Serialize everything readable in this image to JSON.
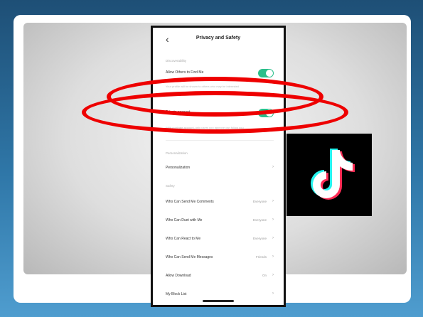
{
  "screen": {
    "title": "Privacy and Safety",
    "back_icon": "chevron-left-icon",
    "discoverability_header": "Discoverability",
    "allow_find_label": "Allow Others to Find Me",
    "allow_find_desc": "Your profile will be shown to others who may be interested",
    "private_label": "Private account",
    "private_desc": "With a private account, only users you approve can follow you",
    "personalization_header": "Personalization",
    "personalization_label": "Personalization",
    "safety_header": "Safety",
    "rows": [
      {
        "label": "Who Can Send Me Comments",
        "value": "Everyone"
      },
      {
        "label": "Who Can Duet with Me",
        "value": "Everyone"
      },
      {
        "label": "Who Can React to Me",
        "value": "Everyone"
      },
      {
        "label": "Who Can Send Me Messages",
        "value": "Friends"
      },
      {
        "label": "Allow Download",
        "value": "On"
      },
      {
        "label": "My Block List",
        "value": ""
      }
    ]
  },
  "toggles": {
    "allow_find": true,
    "private_account": true
  },
  "colors": {
    "toggle_on": "#2bbf8b",
    "highlight_ring": "#ee0000"
  },
  "logo": {
    "icon": "tiktok-logo-icon"
  }
}
